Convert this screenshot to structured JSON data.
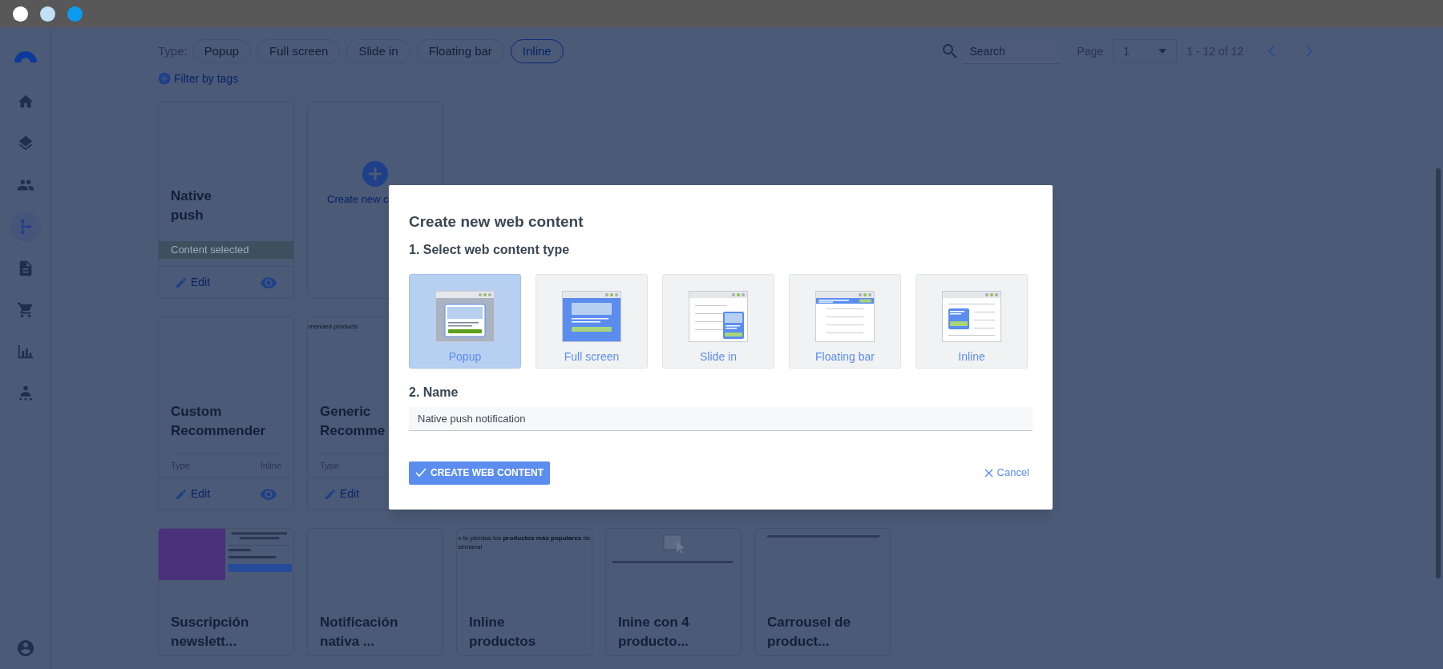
{
  "window_controls": [
    {
      "color": "#ffffff"
    },
    {
      "color": "#bfe0f7"
    },
    {
      "color": "#0a9bf0"
    }
  ],
  "sidebar": {
    "items": [
      {
        "kind": "home",
        "selected": false
      },
      {
        "kind": "layers",
        "selected": false
      },
      {
        "kind": "people",
        "selected": false
      },
      {
        "kind": "branch",
        "selected": true
      },
      {
        "kind": "document",
        "selected": false
      },
      {
        "kind": "cart",
        "selected": false
      },
      {
        "kind": "chart",
        "selected": false
      },
      {
        "kind": "audience",
        "selected": false
      }
    ]
  },
  "filter": {
    "type_label": "Type:",
    "types": [
      {
        "label": "Popup",
        "selected": false
      },
      {
        "label": "Full screen",
        "selected": false
      },
      {
        "label": "Slide in",
        "selected": false
      },
      {
        "label": "Floating bar",
        "selected": false
      },
      {
        "label": "Inline",
        "selected": true
      }
    ],
    "tags_link": "Filter by tags"
  },
  "search": {
    "placeholder": "Search"
  },
  "pagination": {
    "label": "Page",
    "value": "1",
    "range": "1 - 12 of 12"
  },
  "card_rows": [
    [
      {
        "kind": "content",
        "title": "Native push",
        "banner": "Content selected",
        "edit": "Edit",
        "eye": true
      },
      {
        "kind": "create",
        "label": "Create new c"
      }
    ],
    [
      {
        "kind": "content",
        "title": "Custom Recommender",
        "type_label": "Type",
        "type_value": "Inline",
        "edit": "Edit",
        "eye": true
      },
      {
        "kind": "content",
        "preview": {
          "kind": "text",
          "text": "mended products"
        },
        "title": "Generic Recomme",
        "type_label": "Type",
        "edit": "Edit"
      }
    ],
    [
      {
        "kind": "content",
        "preview": {
          "kind": "photo_form"
        },
        "title": "Suscripción newslett..."
      },
      {
        "kind": "content",
        "title": "Notificación nativa ..."
      },
      {
        "kind": "content",
        "preview": {
          "kind": "text",
          "text": "o te pierdas los **productos más populares** de semana!"
        },
        "title": "Inline productos"
      },
      {
        "kind": "content",
        "preview": {
          "kind": "drag_hint"
        },
        "title": "Inine con 4 producto..."
      },
      {
        "kind": "content",
        "preview": {
          "kind": "lines"
        },
        "title": "Carrousel de product..."
      }
    ]
  ],
  "modal": {
    "title": "Create new web content",
    "step1": "1. Select web content type",
    "types": [
      {
        "kind": "popup",
        "label": "Popup",
        "selected": true
      },
      {
        "kind": "fullscreen",
        "label": "Full screen",
        "selected": false
      },
      {
        "kind": "slidein",
        "label": "Slide in",
        "selected": false
      },
      {
        "kind": "floatingbar",
        "label": "Floating bar",
        "selected": false
      },
      {
        "kind": "inline",
        "label": "Inline",
        "selected": false
      }
    ],
    "step2": "2. Name",
    "name_value": "Native push notification",
    "create_label": "CREATE WEB CONTENT",
    "cancel_label": "Cancel"
  }
}
